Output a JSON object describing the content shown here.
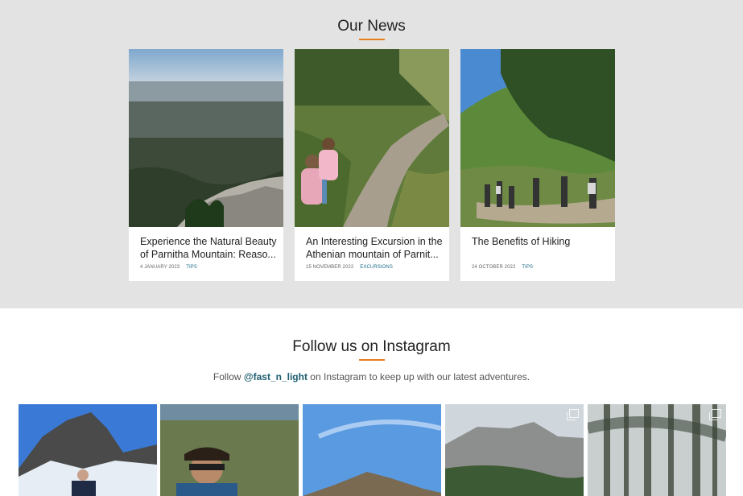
{
  "news": {
    "title": "Our News",
    "cards": [
      {
        "title": "Experience the Natural Beauty of Parnitha Mountain: Reaso...",
        "date": "4 JANUARY 2023",
        "category": "TIPS"
      },
      {
        "title": "An Interesting Excursion in the Athenian mountain of Parnit...",
        "date": "15 NOVEMBER 2022",
        "category": "EXCURSIONS"
      },
      {
        "title": "The Benefits of Hiking",
        "date": "24 OCTOBER 2022",
        "category": "TIPS"
      }
    ]
  },
  "instagram": {
    "title": "Follow us on Instagram",
    "follow_prefix": "Follow",
    "handle": "@fast_n_light",
    "follow_suffix": "on Instagram to keep up with our latest adventures."
  },
  "colors": {
    "accent": "#e87e1e",
    "link": "#1d5e70",
    "news_bg": "#e3e3e3"
  }
}
